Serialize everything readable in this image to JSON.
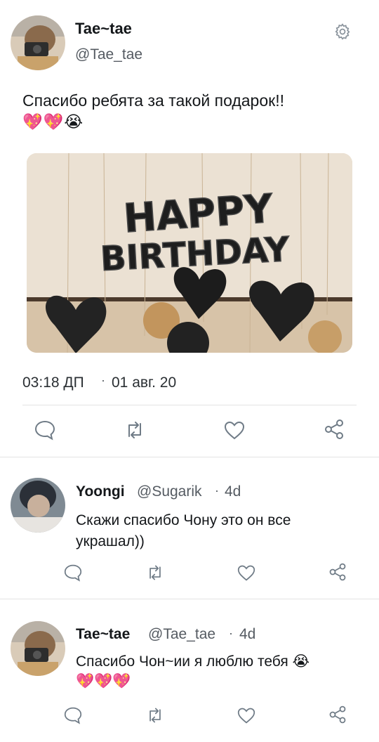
{
  "post": {
    "author_name": "Tae~tae",
    "author_handle": "@Tae_tae",
    "text": "Спасибо ребята за такой подарок!!",
    "emojis": "💖💖😭",
    "photo_text_line1": "HAPPY",
    "photo_text_line2": "BIRTHDAY",
    "time": "03:18 ДП",
    "date": "01 авг. 20"
  },
  "replies": [
    {
      "name": "Yoongi",
      "handle": "@Sugarik",
      "time": "4d",
      "text": "Скажи спасибо Чону это он все украшал))"
    },
    {
      "name": "Tae~tae",
      "handle": "@Tae_tae",
      "time": "4d",
      "text": "Спасибо Чон~ии я люблю тебя 😭",
      "emojis": "💖💖💖"
    }
  ],
  "icons": [
    "settings-gear",
    "reply-bubble",
    "retweet-arrows",
    "like-heart",
    "share-nodes"
  ],
  "colors": {
    "text": "#14171a",
    "muted": "#555b62",
    "icon": "#6f7b86",
    "divider": "#e3e3e3"
  }
}
